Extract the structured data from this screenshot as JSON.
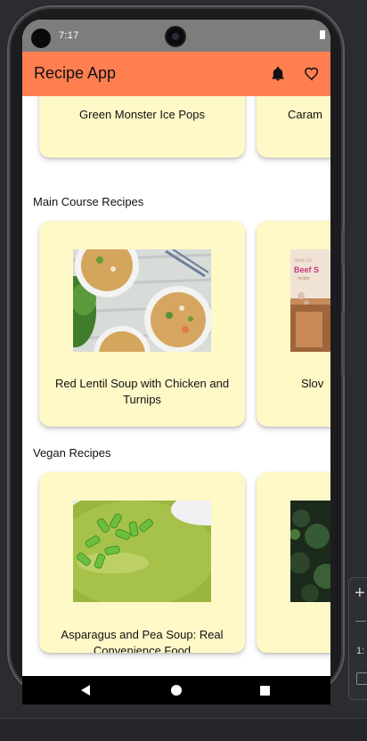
{
  "status_bar": {
    "time": "7:17"
  },
  "app_bar": {
    "title": "Recipe App",
    "icons": [
      "notifications-bell-icon",
      "favorites-heart-icon"
    ],
    "color": "#ff7f50"
  },
  "top_row": {
    "cards": [
      {
        "title": "Green Monster Ice Pops"
      },
      {
        "title": "Caram"
      }
    ]
  },
  "sections": [
    {
      "title": "Main Course Recipes",
      "cards": [
        {
          "title": "Red Lentil Soup with Chicken and\nTurnips",
          "image": "lentil-soup-bowls-photo"
        },
        {
          "title": "Slov",
          "image": "slow-cooker-beef-photo",
          "image_text": "Beef S"
        }
      ]
    },
    {
      "title": "Vegan Recipes",
      "cards": [
        {
          "title": "Asparagus and Pea Soup: Real\nConvenience Food",
          "image": "asparagus-pea-soup-photo"
        },
        {
          "title": "",
          "image": "kale-photo"
        }
      ]
    }
  ],
  "nav_bar": {
    "buttons": [
      "back",
      "home",
      "recent-apps"
    ]
  },
  "emulator_panel": {
    "number": "1:"
  },
  "colors": {
    "card_background": "#fff8c7",
    "status_bar": "#7d7d7d"
  }
}
